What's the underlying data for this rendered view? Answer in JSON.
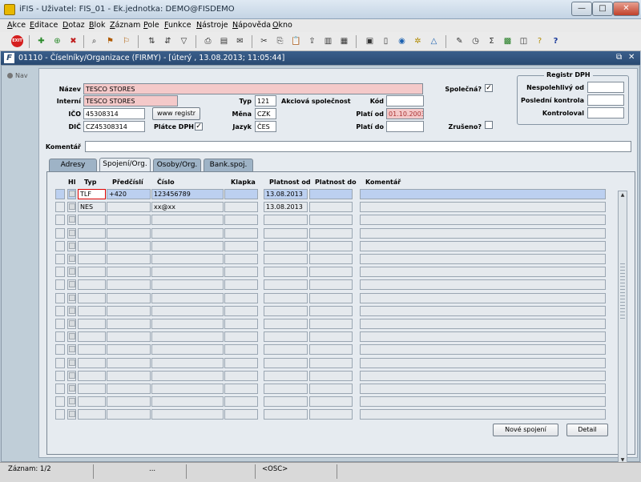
{
  "window": {
    "title": "iFIS - Uživatel: FIS_01 - Ek.jednotka: DEMO@FISDEMO",
    "min": "—",
    "max": "□",
    "close": "✕"
  },
  "menu": [
    "Akce",
    "Editace",
    "Dotaz",
    "Blok",
    "Záznam",
    "Pole",
    "Funkce",
    "Nástroje",
    "Nápověda",
    "Okno"
  ],
  "toolbar": {
    "exit_label": "EXIT"
  },
  "inner": {
    "title": "01110 - Číselníky/Organizace (FIRMY) - [úterý , 13.08.2013; 11:05:44]",
    "icon": "F",
    "restore": "⧉",
    "close": "✕"
  },
  "nav": {
    "label": "Nav"
  },
  "form": {
    "nazev_label": "Název",
    "nazev": "TESCO STORES",
    "interni_label": "Interní",
    "interni": "TESCO STORES",
    "ico_label": "IČO",
    "ico": "45308314",
    "dic_label": "DIČ",
    "dic": "CZ45308314",
    "www_button": "www registr",
    "platce_dph_label": "Plátce DPH",
    "platce_dph_checked": "✓",
    "typ_label": "Typ",
    "typ": "121",
    "typ_text": "Akciová společnost",
    "mena_label": "Měna",
    "mena": "CZK",
    "jazyk_label": "Jazyk",
    "jazyk": "ČES",
    "kod_label": "Kód",
    "kod": "",
    "plati_od_label": "Platí od",
    "plati_od": "01.10.2003",
    "plati_do_label": "Platí do",
    "plati_do": "",
    "spolecna_label": "Společná?",
    "spolecna_checked": "✓",
    "zruseno_label": "Zrušeno?",
    "zruseno_checked": "",
    "komentar_label": "Komentář",
    "komentar": ""
  },
  "registr": {
    "title": "Registr DPH",
    "nespolehlivy_label": "Nespolehlivý od",
    "nespolehlivy": "",
    "posledni_label": "Poslední kontrola",
    "posledni": "",
    "kontroloval_label": "Kontroloval",
    "kontroloval": ""
  },
  "tabs": [
    "Adresy",
    "Spojení/Org.",
    "Osoby/Org.",
    "Bank.spoj."
  ],
  "columns": {
    "hl": "Hl",
    "typ": "Typ",
    "predcisli": "Předčíslí",
    "cislo": "Číslo",
    "klapka": "Klapka",
    "platnost_od": "Platnost od",
    "platnost_do": "Platnost do",
    "komentar": "Komentář"
  },
  "rows": [
    {
      "typ": "TLF",
      "predcisli": "+420",
      "cislo": "123456789",
      "klapka": "",
      "platnost_od": "13.08.2013",
      "platnost_do": "",
      "komentar": ""
    },
    {
      "typ": "NES",
      "predcisli": "",
      "cislo": "xx@xx",
      "klapka": "",
      "platnost_od": "13.08.2013",
      "platnost_do": "",
      "komentar": ""
    }
  ],
  "buttons": {
    "nove_spojeni": "Nové spojení",
    "detail": "Detail"
  },
  "status": {
    "zaznam": "Záznam: 1/2",
    "dots": "...",
    "osc": "<OSC>"
  }
}
